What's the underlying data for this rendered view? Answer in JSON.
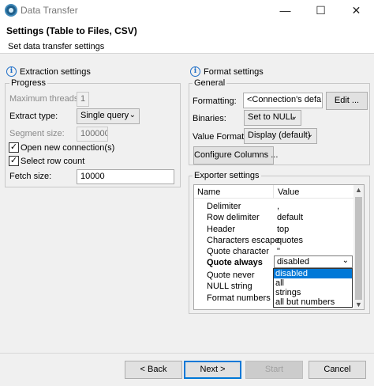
{
  "window": {
    "title": "Data Transfer",
    "minimize": "—",
    "maximize": "☐",
    "close": "✕"
  },
  "header": {
    "title": "Settings (Table to Files, CSV)",
    "subtitle": "Set data transfer settings"
  },
  "extraction": {
    "heading": "Extraction settings",
    "progress_legend": "Progress",
    "max_threads_label": "Maximum threads:",
    "max_threads_value": "1",
    "extract_type_label": "Extract type:",
    "extract_type_value": "Single query",
    "segment_size_label": "Segment size:",
    "segment_size_value": "100000",
    "open_new_connections_label": "Open new connection(s)",
    "open_new_connections_checked": true,
    "select_row_count_label": "Select row count",
    "select_row_count_checked": true,
    "fetch_size_label": "Fetch size:",
    "fetch_size_value": "10000"
  },
  "format": {
    "heading": "Format settings",
    "general_legend": "General",
    "formatting_label": "Formatting:",
    "formatting_value": "<Connection's defa",
    "edit_button": "Edit ...",
    "binaries_label": "Binaries:",
    "binaries_value": "Set to NULL",
    "value_format_label": "Value Format:",
    "value_format_value": "Display (default)",
    "configure_columns_button": "Configure Columns ..."
  },
  "exporter": {
    "legend": "Exporter settings",
    "col_name": "Name",
    "col_value": "Value",
    "rows": [
      {
        "name": "Delimiter",
        "value": ","
      },
      {
        "name": "Row delimiter",
        "value": "default"
      },
      {
        "name": "Header",
        "value": "top"
      },
      {
        "name": "Characters escape",
        "value": "quotes"
      },
      {
        "name": "Quote character",
        "value": "\""
      },
      {
        "name": "Quote always",
        "value": "disabled"
      },
      {
        "name": "Quote never",
        "value": ""
      },
      {
        "name": "NULL string",
        "value": ""
      },
      {
        "name": "Format numbers",
        "value": ""
      }
    ],
    "dropdown_options": [
      "disabled",
      "all",
      "strings",
      "all but numbers"
    ],
    "dropdown_selected": "disabled"
  },
  "footer": {
    "back": "< Back",
    "next": "Next >",
    "start": "Start",
    "cancel": "Cancel"
  },
  "colors": {
    "accent": "#0078d7",
    "info_icon": "#1f6fc8"
  }
}
